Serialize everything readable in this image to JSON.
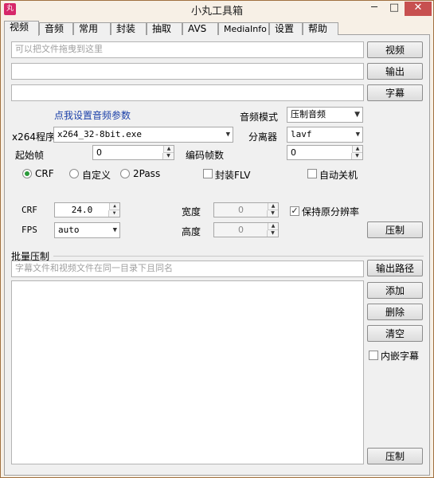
{
  "window": {
    "title": "小丸工具箱",
    "icon_text": "丸",
    "min_glyph": "─",
    "max_glyph": "□",
    "close_glyph": "✕"
  },
  "tabs": [
    "视频",
    "音频",
    "常用",
    "封装",
    "抽取",
    "AVS",
    "MediaInfo",
    "设置",
    "帮助"
  ],
  "video": {
    "drop_placeholder": "可以把文件拖曳到这里",
    "video_button": "视频",
    "output_button": "输出",
    "subtitle_button": "字幕",
    "audio_link": "点我设置音频参数",
    "audio_mode_label": "音频模式",
    "audio_mode_value": "压制音频",
    "x264_label": "x264程序",
    "x264_value": "x264_32-8bit.exe",
    "splitter_label": "分离器",
    "splitter_value": "lavf",
    "start_frame_label": "起始帧",
    "start_frame_value": "0",
    "encode_frames_label": "编码帧数",
    "encode_frames_value": "0",
    "mode_crf": "CRF",
    "mode_custom": "自定义",
    "mode_2pass": "2Pass",
    "mux_flv_label": "封装FLV",
    "auto_shutdown_label": "自动关机",
    "crf_label": "CRF",
    "crf_value": "24.0",
    "fps_label": "FPS",
    "fps_value": "auto",
    "width_label": "宽度",
    "width_value": "0",
    "height_label": "高度",
    "height_value": "0",
    "keep_res_label": "保持原分辨率",
    "keep_res_check": "✓",
    "compress_button": "压制"
  },
  "batch": {
    "group_label": "批量压制",
    "hint_placeholder": "字幕文件和视频文件在同一目录下且同名",
    "output_path_button": "输出路径",
    "add_button": "添加",
    "delete_button": "删除",
    "clear_button": "清空",
    "embed_sub_label": "内嵌字幕",
    "compress_button": "压制"
  },
  "icons": {
    "dropdown": "chevron-down-icon",
    "spin_up": "spin-up-icon",
    "spin_down": "spin-down-icon"
  },
  "colors": {
    "frame": "#f7f0e6",
    "close_button": "#c75050",
    "link": "#1a3fa8",
    "radio_dot": "#2a9a3a"
  }
}
